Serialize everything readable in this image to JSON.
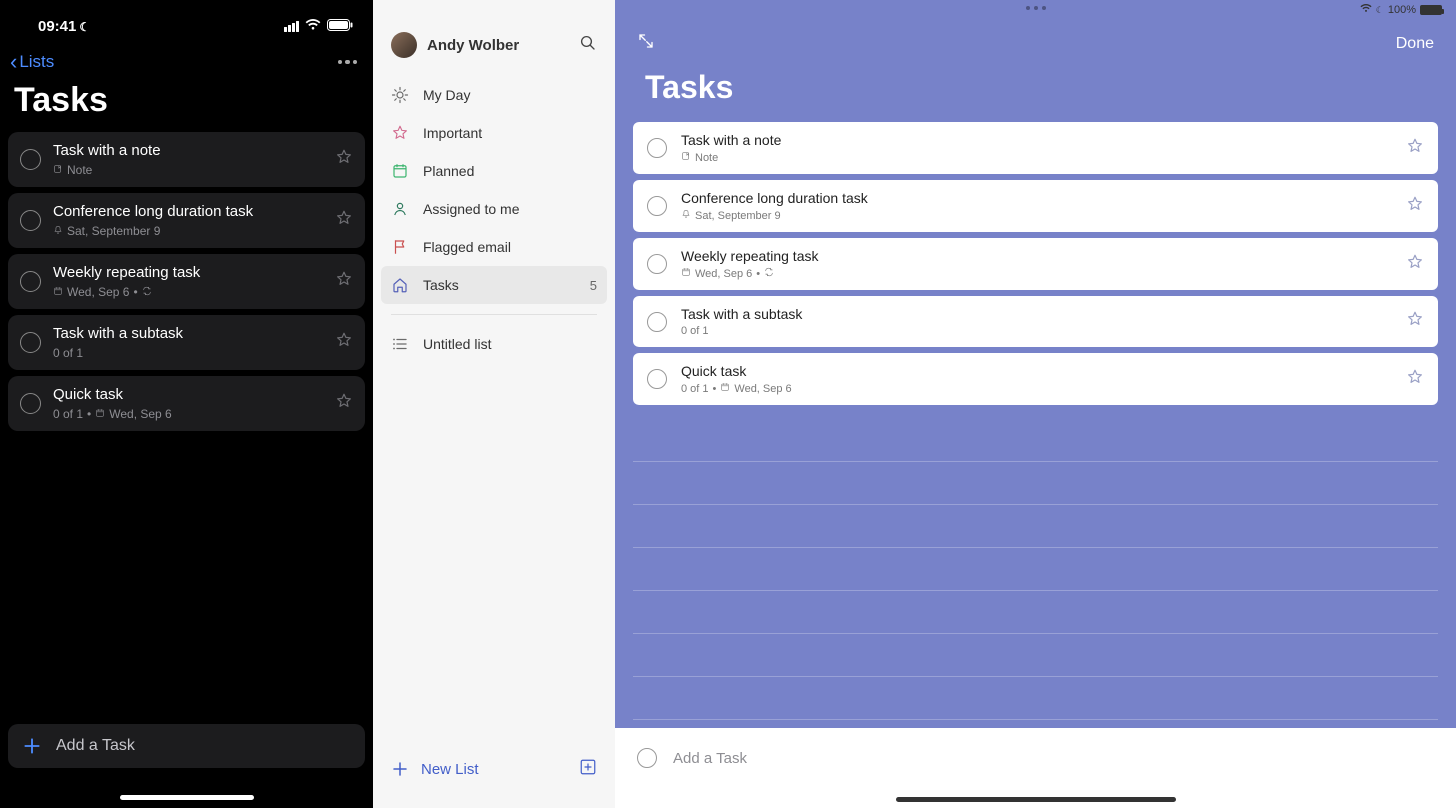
{
  "phone": {
    "time": "09:41",
    "back_label": "Lists",
    "title": "Tasks",
    "tasks": [
      {
        "title": "Task with a note",
        "meta_icon": "note",
        "meta_text": "Note"
      },
      {
        "title": "Conference long duration task",
        "meta_icon": "bell",
        "meta_text": "Sat, September 9"
      },
      {
        "title": "Weekly repeating task",
        "meta_icon": "cal",
        "meta_text": "Wed, Sep 6",
        "extra_icon": "repeat"
      },
      {
        "title": "Task with a subtask",
        "meta_icon": "",
        "meta_text": "0 of 1"
      },
      {
        "title": "Quick task",
        "meta_icon": "",
        "meta_text": "0 of 1",
        "extra_icon": "cal",
        "extra_text": "Wed, Sep 6"
      }
    ],
    "add_label": "Add a Task"
  },
  "sidebar": {
    "user_name": "Andy Wolber",
    "items": [
      {
        "icon": "sun",
        "label": "My Day",
        "color": "#6b6b6b"
      },
      {
        "icon": "star",
        "label": "Important",
        "color": "#d26b8f"
      },
      {
        "icon": "calendar",
        "label": "Planned",
        "color": "#3cb56f"
      },
      {
        "icon": "person",
        "label": "Assigned to me",
        "color": "#2f7a5f"
      },
      {
        "icon": "flag",
        "label": "Flagged email",
        "color": "#c94f4f"
      },
      {
        "icon": "home",
        "label": "Tasks",
        "color": "#5561b8",
        "count": "5",
        "active": true
      }
    ],
    "other": [
      {
        "icon": "list",
        "label": "Untitled list",
        "color": "#6b6b6b"
      }
    ],
    "new_list": "New List"
  },
  "main": {
    "battery_text": "100%",
    "done": "Done",
    "title": "Tasks",
    "add_placeholder": "Add a Task",
    "tasks": [
      {
        "title": "Task with a note",
        "meta_icon": "note",
        "meta_text": "Note"
      },
      {
        "title": "Conference long duration task",
        "meta_icon": "bell",
        "meta_text": "Sat, September 9"
      },
      {
        "title": "Weekly repeating task",
        "meta_icon": "cal",
        "meta_text": "Wed, Sep 6",
        "extra_icon": "repeat"
      },
      {
        "title": "Task with a subtask",
        "meta_icon": "",
        "meta_text": "0 of 1"
      },
      {
        "title": "Quick task",
        "meta_icon": "",
        "meta_text": "0 of 1",
        "extra_icon": "cal",
        "extra_text": "Wed, Sep 6"
      }
    ]
  }
}
